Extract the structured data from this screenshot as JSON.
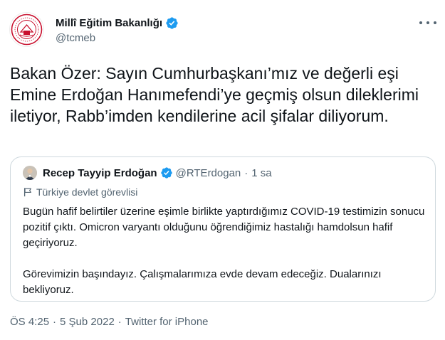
{
  "author": {
    "name": "Millî Eğitim Bakanlığı",
    "handle": "@tcmeb",
    "verified": true,
    "avatar_icon": "meb-logo-icon",
    "accent_color": "#c8102e"
  },
  "tweet": {
    "text": "Bakan Özer: Sayın Cumhurbaşkanı’mız ve değerli eşi Emine Erdoğan Hanımefendi’ye geçmiş olsun dileklerimi iletiyor, Rabb’imden kendilerine acil şifalar diliyorum."
  },
  "quoted": {
    "name": "Recep Tayyip Erdoğan",
    "handle": "@RTErdogan",
    "separator": "·",
    "time": "1 sa",
    "verified": true,
    "label": "Türkiye devlet görevlisi",
    "paragraphs": [
      "Bugün hafif belirtiler üzerine eşimle birlikte yaptırdığımız COVID-19 testimizin sonucu pozitif çıktı. Omicron varyantı olduğunu öğrendiğimiz hastalığı hamdolsun hafif geçiriyoruz.",
      "Görevimizin başındayız. Çalışmalarımıza evde devam edeceğiz. Dualarınızı bekliyoruz."
    ]
  },
  "footer": {
    "time": "ÖS 4:25",
    "separator": "·",
    "date": "5 Şub 2022",
    "source": "Twitter for iPhone"
  },
  "colors": {
    "verified": "#1d9bf0",
    "secondary_text": "#536471",
    "border": "#cfd9de"
  }
}
